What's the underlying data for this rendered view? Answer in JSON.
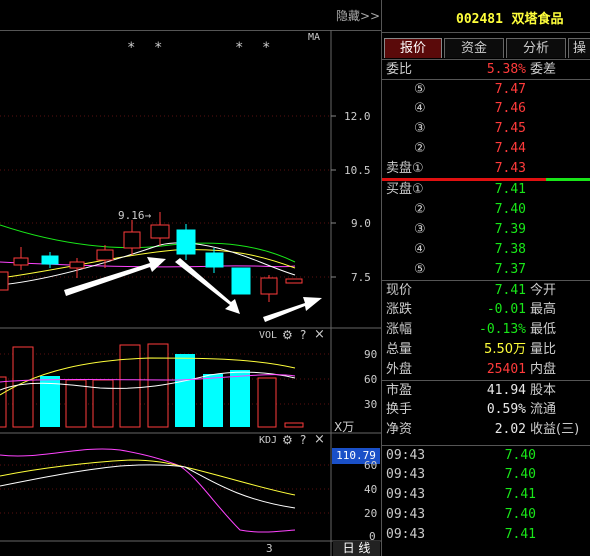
{
  "header": {
    "hide_label": "隐藏>>",
    "stock_code": "002481",
    "stock_name": "双塔食品"
  },
  "chart": {
    "ma_label": "MA",
    "star_marks": [
      "*",
      "*",
      "*",
      "*"
    ],
    "peak_label": "9.16→",
    "price_ticks": [
      "12.0",
      "10.5",
      "9.0",
      "7.5"
    ],
    "vol_label": "VOL",
    "vol_ticks": [
      "90",
      "60",
      "30"
    ],
    "vol_unit": "X万",
    "kdj_label": "KDJ",
    "kdj_ticks": [
      "60",
      "40",
      "20",
      "0"
    ],
    "kdj_value_box": "110.79",
    "bottom_date": "3",
    "period_label": "日 线",
    "icons": {
      "gear": "gear-icon",
      "help": "?",
      "close": "×"
    }
  },
  "tabs": [
    {
      "label": "报价",
      "active": true
    },
    {
      "label": "资金",
      "active": false
    },
    {
      "label": "分析",
      "active": false
    },
    {
      "label": "操",
      "active": false
    }
  ],
  "order_book": {
    "weibi_label": "委比",
    "weibi_value": "5.38%",
    "weicha_label": "委差",
    "asks": [
      {
        "label": "⑤",
        "price": "7.47"
      },
      {
        "label": "④",
        "price": "7.46"
      },
      {
        "label": "③",
        "price": "7.45"
      },
      {
        "label": "②",
        "price": "7.44"
      },
      {
        "label": "卖盘①",
        "price": "7.43"
      }
    ],
    "bids": [
      {
        "label": "买盘①",
        "price": "7.41"
      },
      {
        "label": "②",
        "price": "7.40"
      },
      {
        "label": "③",
        "price": "7.39"
      },
      {
        "label": "④",
        "price": "7.38"
      },
      {
        "label": "⑤",
        "price": "7.37"
      }
    ]
  },
  "quote": [
    {
      "label": "现价",
      "value": "7.41",
      "color": "green",
      "label2": "今开"
    },
    {
      "label": "涨跌",
      "value": "-0.01",
      "color": "green",
      "label2": "最高"
    },
    {
      "label": "涨幅",
      "value": "-0.13%",
      "color": "green",
      "label2": "最低"
    },
    {
      "label": "总量",
      "value": "5.50万",
      "color": "yellow",
      "label2": "量比"
    },
    {
      "label": "外盘",
      "value": "25401",
      "color": "red",
      "label2": "内盘"
    },
    {
      "label": "市盈",
      "value": "41.94",
      "color": "white",
      "label2": "股本"
    },
    {
      "label": "换手",
      "value": "0.59%",
      "color": "white",
      "label2": "流通"
    },
    {
      "label": "净资",
      "value": "2.02",
      "color": "white",
      "label2": "收益(三)"
    }
  ],
  "ticks": [
    {
      "time": "09:43",
      "price": "7.40"
    },
    {
      "time": "09:43",
      "price": "7.40"
    },
    {
      "time": "09:43",
      "price": "7.41"
    },
    {
      "time": "09:43",
      "price": "7.40"
    },
    {
      "time": "09:43",
      "price": "7.41"
    }
  ],
  "colors": {
    "up": "#ff3b3b",
    "down": "#00ffff",
    "down_text": "#19e619",
    "ma5": "#ffffff",
    "ma10": "#ffff3b",
    "ma20": "#ff44ff",
    "ma30": "#19e619"
  }
}
